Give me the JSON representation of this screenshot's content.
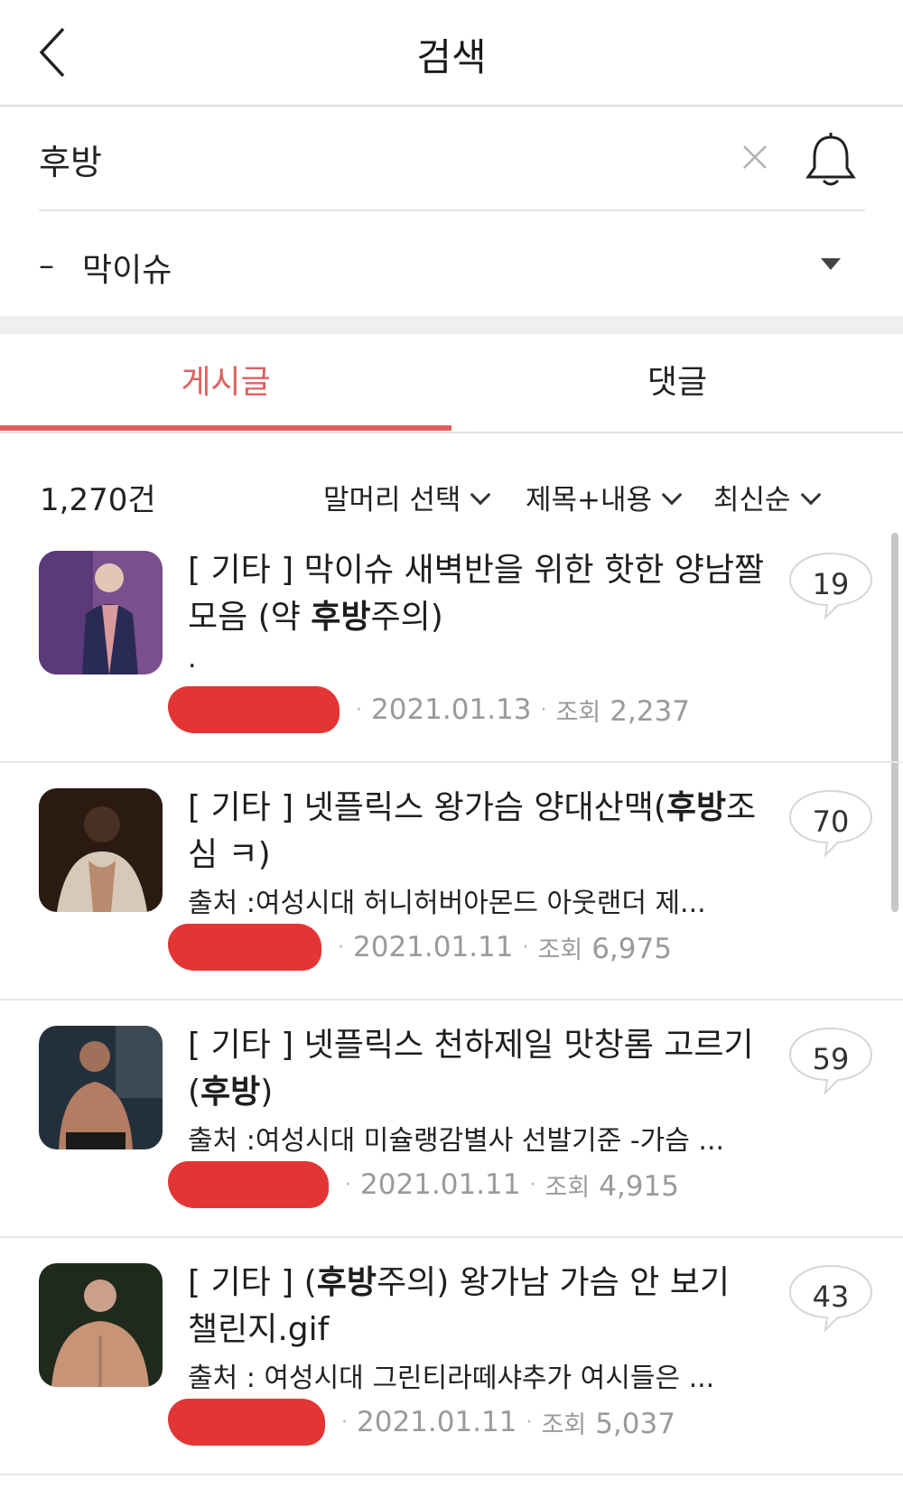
{
  "header": {
    "title": "검색"
  },
  "search": {
    "query": "후방"
  },
  "board": {
    "prefix": "–",
    "name": "막이슈"
  },
  "tabs": [
    {
      "label": "게시글",
      "active": true
    },
    {
      "label": "댓글",
      "active": false
    }
  ],
  "results": {
    "count": "1,270건",
    "filters": [
      "말머리 선택",
      "제목+내용",
      "최신순"
    ]
  },
  "colors": {
    "accent": "#e06060",
    "redacted": "#e43535",
    "meta": "#9a9a9a"
  },
  "posts": [
    {
      "title_before": "[ 기타 ] 막이슈 새벽반을 위한 핫한 양남짤 모음 (약 ",
      "keyword": "후방",
      "title_after": "주의)",
      "preview": ".",
      "date": "2021.01.13",
      "views_label": "조회",
      "views": "2,237",
      "comments": "19"
    },
    {
      "title_before": "[ 기타 ] 넷플릭스 왕가슴 양대산맥(",
      "keyword": "후방",
      "title_after": "조심 ㅋ)",
      "preview": "출처 :여성시대 허니허버아몬드 아웃랜더 제...",
      "date": "2021.01.11",
      "views_label": "조회",
      "views": "6,975",
      "comments": "70"
    },
    {
      "title_before": "[ 기타 ] 넷플릭스 천하제일 맛창롬 고르기(",
      "keyword": "후방",
      "title_after": ")",
      "preview": "출처 :여성시대 미슐랭감별사 선발기준 -가슴 ...",
      "date": "2021.01.11",
      "views_label": "조회",
      "views": "4,915",
      "comments": "59"
    },
    {
      "title_before": "[ 기타 ] (",
      "keyword": "후방",
      "title_after": "주의) 왕가남 가슴 안 보기 챌린지.gif",
      "preview": "출처 : 여성시대 그린티라떼샤추가 여시들은 ...",
      "date": "2021.01.11",
      "views_label": "조회",
      "views": "5,037",
      "comments": "43"
    }
  ]
}
